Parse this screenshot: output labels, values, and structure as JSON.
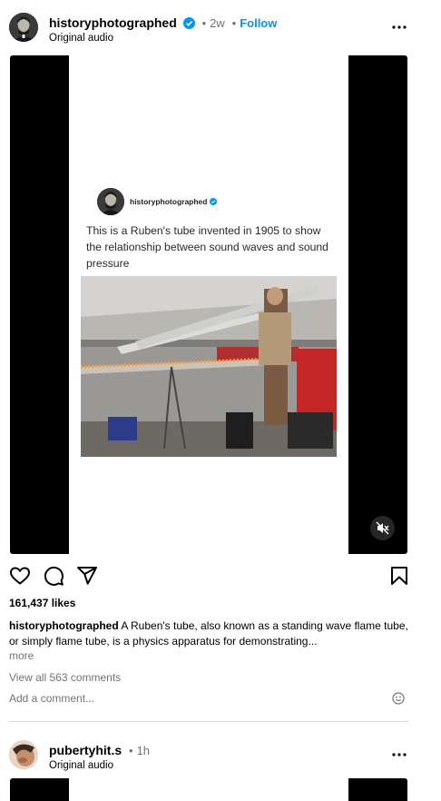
{
  "post1": {
    "username": "historyphotographed",
    "separator": "•",
    "time": "2w",
    "follow_label": "Follow",
    "audio": "Original audio",
    "media": {
      "inner_username": "historyphotographed",
      "inner_caption": "This is a Ruben's tube invented in 1905 to show the relationship between sound waves and sound pressure"
    },
    "likes": "161,437 likes",
    "caption_user": "historyphotographed",
    "caption_text": "A Ruben's tube, also known as a standing wave flame tube, or simply flame tube, is a physics apparatus for demonstrating...",
    "more_label": "more",
    "view_comments": "View all 563 comments",
    "add_comment_placeholder": "Add a comment..."
  },
  "post2": {
    "username": "pubertyhit.s",
    "separator": "•",
    "time": "1h",
    "audio": "Original audio"
  },
  "icons": {
    "verified": "verified-badge-icon",
    "more": "more-options-icon",
    "like": "heart-icon",
    "comment": "comment-icon",
    "share": "paper-plane-icon",
    "save": "bookmark-icon",
    "mute": "speaker-muted-icon",
    "emoji": "emoji-icon"
  },
  "colors": {
    "link": "#0095f6",
    "secondary_text": "#737373",
    "divider": "#dbdbdb"
  }
}
